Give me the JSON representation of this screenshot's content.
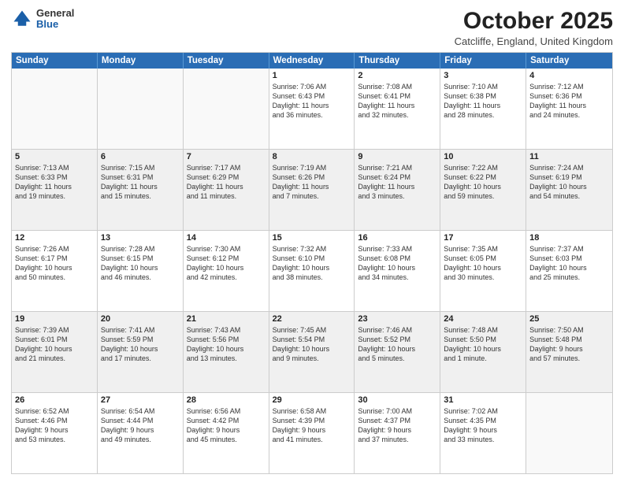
{
  "header": {
    "logo_general": "General",
    "logo_blue": "Blue",
    "month": "October 2025",
    "location": "Catcliffe, England, United Kingdom"
  },
  "weekdays": [
    "Sunday",
    "Monday",
    "Tuesday",
    "Wednesday",
    "Thursday",
    "Friday",
    "Saturday"
  ],
  "rows": [
    [
      {
        "day": "",
        "text": "",
        "empty": true
      },
      {
        "day": "",
        "text": "",
        "empty": true
      },
      {
        "day": "",
        "text": "",
        "empty": true
      },
      {
        "day": "1",
        "text": "Sunrise: 7:06 AM\nSunset: 6:43 PM\nDaylight: 11 hours\nand 36 minutes."
      },
      {
        "day": "2",
        "text": "Sunrise: 7:08 AM\nSunset: 6:41 PM\nDaylight: 11 hours\nand 32 minutes."
      },
      {
        "day": "3",
        "text": "Sunrise: 7:10 AM\nSunset: 6:38 PM\nDaylight: 11 hours\nand 28 minutes."
      },
      {
        "day": "4",
        "text": "Sunrise: 7:12 AM\nSunset: 6:36 PM\nDaylight: 11 hours\nand 24 minutes."
      }
    ],
    [
      {
        "day": "5",
        "text": "Sunrise: 7:13 AM\nSunset: 6:33 PM\nDaylight: 11 hours\nand 19 minutes.",
        "shaded": true
      },
      {
        "day": "6",
        "text": "Sunrise: 7:15 AM\nSunset: 6:31 PM\nDaylight: 11 hours\nand 15 minutes.",
        "shaded": true
      },
      {
        "day": "7",
        "text": "Sunrise: 7:17 AM\nSunset: 6:29 PM\nDaylight: 11 hours\nand 11 minutes.",
        "shaded": true
      },
      {
        "day": "8",
        "text": "Sunrise: 7:19 AM\nSunset: 6:26 PM\nDaylight: 11 hours\nand 7 minutes.",
        "shaded": true
      },
      {
        "day": "9",
        "text": "Sunrise: 7:21 AM\nSunset: 6:24 PM\nDaylight: 11 hours\nand 3 minutes.",
        "shaded": true
      },
      {
        "day": "10",
        "text": "Sunrise: 7:22 AM\nSunset: 6:22 PM\nDaylight: 10 hours\nand 59 minutes.",
        "shaded": true
      },
      {
        "day": "11",
        "text": "Sunrise: 7:24 AM\nSunset: 6:19 PM\nDaylight: 10 hours\nand 54 minutes.",
        "shaded": true
      }
    ],
    [
      {
        "day": "12",
        "text": "Sunrise: 7:26 AM\nSunset: 6:17 PM\nDaylight: 10 hours\nand 50 minutes."
      },
      {
        "day": "13",
        "text": "Sunrise: 7:28 AM\nSunset: 6:15 PM\nDaylight: 10 hours\nand 46 minutes."
      },
      {
        "day": "14",
        "text": "Sunrise: 7:30 AM\nSunset: 6:12 PM\nDaylight: 10 hours\nand 42 minutes."
      },
      {
        "day": "15",
        "text": "Sunrise: 7:32 AM\nSunset: 6:10 PM\nDaylight: 10 hours\nand 38 minutes."
      },
      {
        "day": "16",
        "text": "Sunrise: 7:33 AM\nSunset: 6:08 PM\nDaylight: 10 hours\nand 34 minutes."
      },
      {
        "day": "17",
        "text": "Sunrise: 7:35 AM\nSunset: 6:05 PM\nDaylight: 10 hours\nand 30 minutes."
      },
      {
        "day": "18",
        "text": "Sunrise: 7:37 AM\nSunset: 6:03 PM\nDaylight: 10 hours\nand 25 minutes."
      }
    ],
    [
      {
        "day": "19",
        "text": "Sunrise: 7:39 AM\nSunset: 6:01 PM\nDaylight: 10 hours\nand 21 minutes.",
        "shaded": true
      },
      {
        "day": "20",
        "text": "Sunrise: 7:41 AM\nSunset: 5:59 PM\nDaylight: 10 hours\nand 17 minutes.",
        "shaded": true
      },
      {
        "day": "21",
        "text": "Sunrise: 7:43 AM\nSunset: 5:56 PM\nDaylight: 10 hours\nand 13 minutes.",
        "shaded": true
      },
      {
        "day": "22",
        "text": "Sunrise: 7:45 AM\nSunset: 5:54 PM\nDaylight: 10 hours\nand 9 minutes.",
        "shaded": true
      },
      {
        "day": "23",
        "text": "Sunrise: 7:46 AM\nSunset: 5:52 PM\nDaylight: 10 hours\nand 5 minutes.",
        "shaded": true
      },
      {
        "day": "24",
        "text": "Sunrise: 7:48 AM\nSunset: 5:50 PM\nDaylight: 10 hours\nand 1 minute.",
        "shaded": true
      },
      {
        "day": "25",
        "text": "Sunrise: 7:50 AM\nSunset: 5:48 PM\nDaylight: 9 hours\nand 57 minutes.",
        "shaded": true
      }
    ],
    [
      {
        "day": "26",
        "text": "Sunrise: 6:52 AM\nSunset: 4:46 PM\nDaylight: 9 hours\nand 53 minutes."
      },
      {
        "day": "27",
        "text": "Sunrise: 6:54 AM\nSunset: 4:44 PM\nDaylight: 9 hours\nand 49 minutes."
      },
      {
        "day": "28",
        "text": "Sunrise: 6:56 AM\nSunset: 4:42 PM\nDaylight: 9 hours\nand 45 minutes."
      },
      {
        "day": "29",
        "text": "Sunrise: 6:58 AM\nSunset: 4:39 PM\nDaylight: 9 hours\nand 41 minutes."
      },
      {
        "day": "30",
        "text": "Sunrise: 7:00 AM\nSunset: 4:37 PM\nDaylight: 9 hours\nand 37 minutes."
      },
      {
        "day": "31",
        "text": "Sunrise: 7:02 AM\nSunset: 4:35 PM\nDaylight: 9 hours\nand 33 minutes."
      },
      {
        "day": "",
        "text": "",
        "empty": true
      }
    ]
  ]
}
